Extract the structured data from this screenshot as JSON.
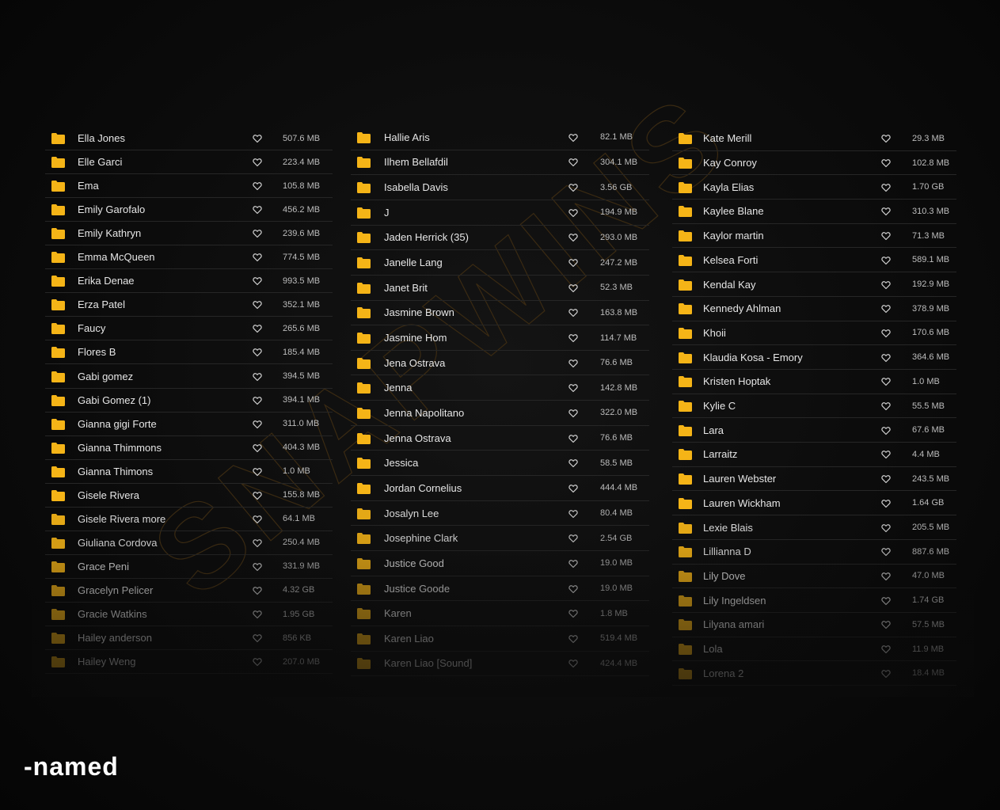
{
  "columns": [
    {
      "items": [
        {
          "name": "Ella Jones",
          "size": "507.6 MB"
        },
        {
          "name": "Elle Garci",
          "size": "223.4 MB"
        },
        {
          "name": "Ema",
          "size": "105.8 MB"
        },
        {
          "name": "Emily Garofalo",
          "size": "456.2 MB"
        },
        {
          "name": "Emily Kathryn",
          "size": "239.6 MB"
        },
        {
          "name": "Emma McQueen",
          "size": "774.5 MB"
        },
        {
          "name": "Erika Denae",
          "size": "993.5 MB"
        },
        {
          "name": "Erza Patel",
          "size": "352.1 MB"
        },
        {
          "name": "Faucy",
          "size": "265.6 MB"
        },
        {
          "name": "Flores B",
          "size": "185.4 MB"
        },
        {
          "name": "Gabi gomez",
          "size": "394.5 MB"
        },
        {
          "name": "Gabi Gomez (1)",
          "size": "394.1 MB"
        },
        {
          "name": "Gianna gigi Forte",
          "size": "311.0 MB"
        },
        {
          "name": "Gianna Thimmons",
          "size": "404.3 MB"
        },
        {
          "name": "Gianna Thimons",
          "size": "1.0 MB"
        },
        {
          "name": "Gisele Rivera",
          "size": "155.8 MB"
        },
        {
          "name": "Gisele Rivera more",
          "size": "64.1 MB"
        },
        {
          "name": "Giuliana Cordova",
          "size": "250.4 MB"
        },
        {
          "name": "Grace Peni",
          "size": "331.9 MB"
        },
        {
          "name": "Gracelyn Pelicer",
          "size": "4.32 GB"
        },
        {
          "name": "Gracie Watkins",
          "size": "1.95 GB"
        },
        {
          "name": "Hailey anderson",
          "size": "856 KB"
        },
        {
          "name": "Hailey Weng",
          "size": "207.0 MB"
        }
      ]
    },
    {
      "items": [
        {
          "name": "Hallie Aris",
          "size": "82.1 MB"
        },
        {
          "name": "Ilhem Bellafdil",
          "size": "304.1 MB"
        },
        {
          "name": "Isabella Davis",
          "size": "3.56 GB"
        },
        {
          "name": "J",
          "size": "194.9 MB"
        },
        {
          "name": "Jaden Herrick (35)",
          "size": "293.0 MB"
        },
        {
          "name": "Janelle Lang",
          "size": "247.2 MB"
        },
        {
          "name": "Janet Brit",
          "size": "52.3 MB"
        },
        {
          "name": "Jasmine Brown",
          "size": "163.8 MB"
        },
        {
          "name": "Jasmine Hom",
          "size": "114.7 MB"
        },
        {
          "name": "Jena Ostrava",
          "size": "76.6 MB"
        },
        {
          "name": "Jenna",
          "size": "142.8 MB"
        },
        {
          "name": "Jenna Napolitano",
          "size": "322.0 MB"
        },
        {
          "name": "Jenna Ostrava",
          "size": "76.6 MB"
        },
        {
          "name": "Jessica",
          "size": "58.5 MB"
        },
        {
          "name": "Jordan Cornelius",
          "size": "444.4 MB"
        },
        {
          "name": "Josalyn Lee",
          "size": "80.4 MB"
        },
        {
          "name": "Josephine Clark",
          "size": "2.54 GB"
        },
        {
          "name": "Justice Good",
          "size": "19.0 MB"
        },
        {
          "name": "Justice Goode",
          "size": "19.0 MB"
        },
        {
          "name": "Karen",
          "size": "1.8 MB"
        },
        {
          "name": "Karen Liao",
          "size": "519.4 MB"
        },
        {
          "name": "Karen Liao [Sound]",
          "size": "424.4 MB"
        }
      ]
    },
    {
      "items": [
        {
          "name": "Kate Merill",
          "size": "29.3 MB"
        },
        {
          "name": "Kay Conroy",
          "size": "102.8 MB"
        },
        {
          "name": "Kayla Elias",
          "size": "1.70 GB"
        },
        {
          "name": "Kaylee Blane",
          "size": "310.3 MB"
        },
        {
          "name": "Kaylor martin",
          "size": "71.3 MB"
        },
        {
          "name": "Kelsea Forti",
          "size": "589.1 MB"
        },
        {
          "name": "Kendal Kay",
          "size": "192.9 MB"
        },
        {
          "name": "Kennedy Ahlman",
          "size": "378.9 MB"
        },
        {
          "name": "Khoii",
          "size": "170.6 MB"
        },
        {
          "name": "Klaudia Kosa - Emory",
          "size": "364.6 MB"
        },
        {
          "name": "Kristen Hoptak",
          "size": "1.0 MB"
        },
        {
          "name": "Kylie C",
          "size": "55.5 MB"
        },
        {
          "name": "Lara",
          "size": "67.6 MB"
        },
        {
          "name": "Larraitz",
          "size": "4.4 MB"
        },
        {
          "name": "Lauren Webster",
          "size": "243.5 MB"
        },
        {
          "name": "Lauren Wickham",
          "size": "1.64 GB"
        },
        {
          "name": "Lexie Blais",
          "size": "205.5 MB"
        },
        {
          "name": "Lillianna D",
          "size": "887.6 MB"
        },
        {
          "name": "Lily Dove",
          "size": "47.0 MB"
        },
        {
          "name": "Lily Ingeldsen",
          "size": "1.74 GB"
        },
        {
          "name": "Lilyana amari",
          "size": "57.5 MB"
        },
        {
          "name": "Lola",
          "size": "11.9 MB"
        },
        {
          "name": "Lorena 2",
          "size": "18.4 MB"
        }
      ]
    }
  ],
  "brand": {
    "text": "-named"
  },
  "watermark": {
    "text": "SNAPWINS"
  },
  "colors": {
    "folder": "#f5b417",
    "background": "#0b0b0b",
    "divider": "#262626"
  }
}
